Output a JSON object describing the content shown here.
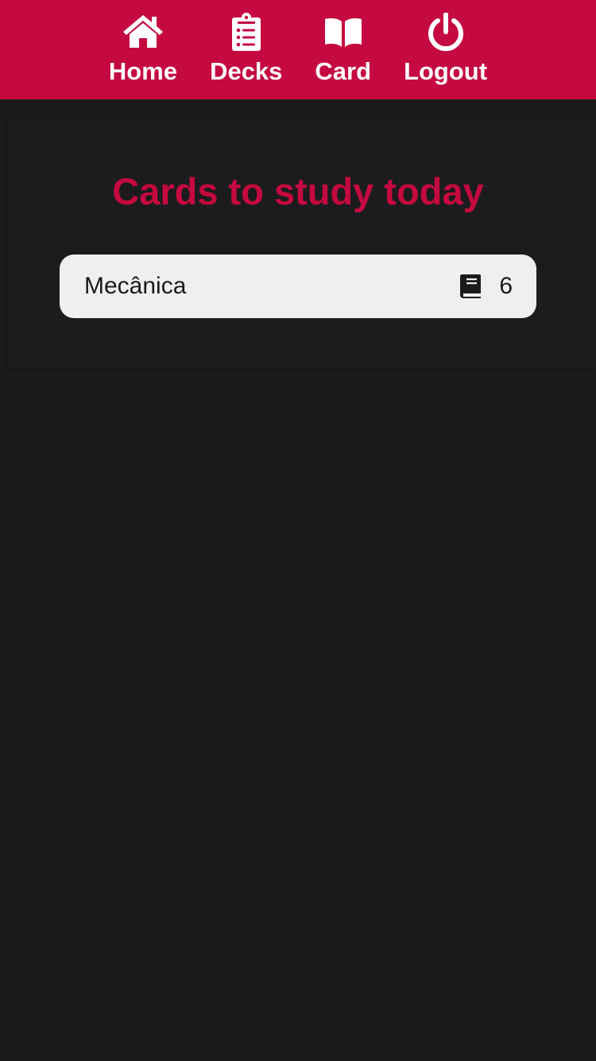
{
  "nav": {
    "items": [
      {
        "label": "Home",
        "icon": "home-icon"
      },
      {
        "label": "Decks",
        "icon": "clipboard-list-icon"
      },
      {
        "label": "Card",
        "icon": "open-book-icon"
      },
      {
        "label": "Logout",
        "icon": "power-icon"
      }
    ]
  },
  "main": {
    "title": "Cards to study today",
    "decks": [
      {
        "name": "Mecânica",
        "count": "6",
        "icon": "book-icon"
      }
    ]
  },
  "colors": {
    "accent": "#c40a40",
    "background": "#1b1b1d",
    "card_background": "#efefef",
    "nav_text": "#ffffff"
  }
}
